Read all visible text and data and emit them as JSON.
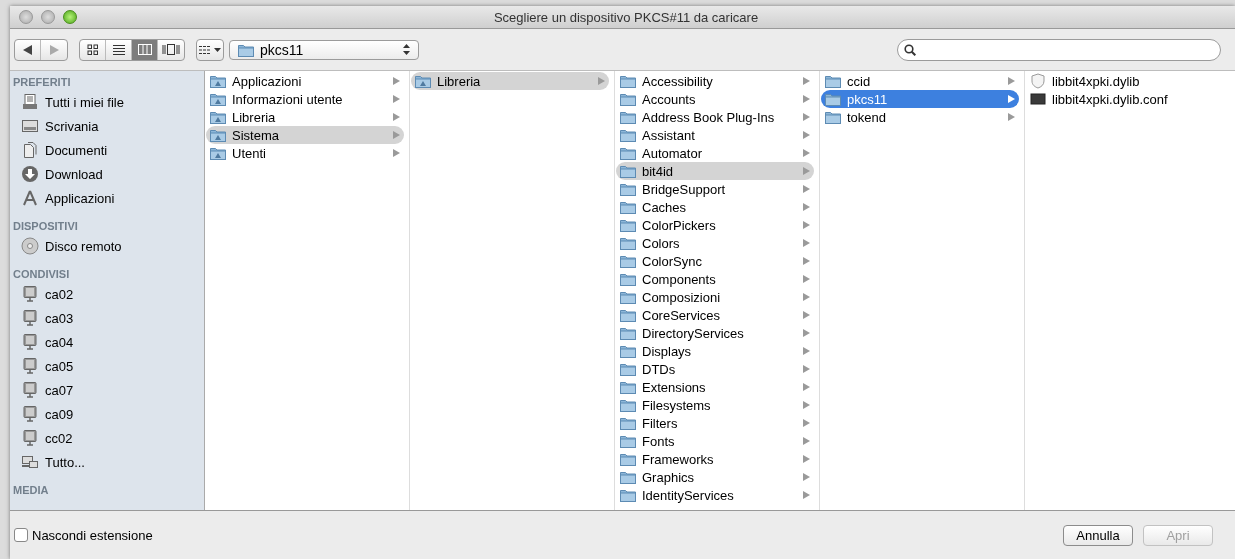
{
  "window": {
    "title": "Scegliere un dispositivo PKCS#11 da caricare"
  },
  "toolbar": {
    "view_buttons": [
      {
        "kind": "icons",
        "selected": false
      },
      {
        "kind": "list",
        "selected": false
      },
      {
        "kind": "columns",
        "selected": true
      },
      {
        "kind": "coverflow",
        "selected": false
      }
    ],
    "path_popup": "pkcs11"
  },
  "sidebar": {
    "sections": [
      {
        "title": "PREFERITI",
        "items": [
          {
            "label": "Tutti i miei file",
            "kind": "all-files"
          },
          {
            "label": "Scrivania",
            "kind": "desktop"
          },
          {
            "label": "Documenti",
            "kind": "documents"
          },
          {
            "label": "Download",
            "kind": "download"
          },
          {
            "label": "Applicazioni",
            "kind": "applications"
          }
        ]
      },
      {
        "title": "DISPOSITIVI",
        "items": [
          {
            "label": "Disco remoto",
            "kind": "disc"
          }
        ]
      },
      {
        "title": "CONDIVISI",
        "items": [
          {
            "label": "ca02",
            "kind": "computer"
          },
          {
            "label": "ca03",
            "kind": "computer"
          },
          {
            "label": "ca04",
            "kind": "computer"
          },
          {
            "label": "ca05",
            "kind": "computer"
          },
          {
            "label": "ca07",
            "kind": "computer"
          },
          {
            "label": "ca09",
            "kind": "computer"
          },
          {
            "label": "cc02",
            "kind": "computer"
          },
          {
            "label": "Tutto...",
            "kind": "network"
          }
        ]
      },
      {
        "title": "MEDIA"
      }
    ]
  },
  "columns": [
    {
      "items": [
        {
          "name": "Applicazioni",
          "kind": "special-folder",
          "selected": false
        },
        {
          "name": "Informazioni utente",
          "kind": "special-folder",
          "selected": false
        },
        {
          "name": "Libreria",
          "kind": "special-folder",
          "selected": false
        },
        {
          "name": "Sistema",
          "kind": "special-folder",
          "selected": true
        },
        {
          "name": "Utenti",
          "kind": "special-folder",
          "selected": false
        }
      ]
    },
    {
      "items": [
        {
          "name": "Libreria",
          "kind": "special-folder",
          "selected": true
        }
      ]
    },
    {
      "items": [
        {
          "name": "Accessibility",
          "kind": "folder",
          "selected": false
        },
        {
          "name": "Accounts",
          "kind": "folder",
          "selected": false
        },
        {
          "name": "Address Book Plug-Ins",
          "kind": "folder",
          "selected": false
        },
        {
          "name": "Assistant",
          "kind": "folder",
          "selected": false
        },
        {
          "name": "Automator",
          "kind": "folder",
          "selected": false
        },
        {
          "name": "bit4id",
          "kind": "folder",
          "selected": true
        },
        {
          "name": "BridgeSupport",
          "kind": "folder",
          "selected": false
        },
        {
          "name": "Caches",
          "kind": "folder",
          "selected": false
        },
        {
          "name": "ColorPickers",
          "kind": "folder",
          "selected": false
        },
        {
          "name": "Colors",
          "kind": "folder",
          "selected": false
        },
        {
          "name": "ColorSync",
          "kind": "folder",
          "selected": false
        },
        {
          "name": "Components",
          "kind": "folder",
          "selected": false
        },
        {
          "name": "Composizioni",
          "kind": "folder",
          "selected": false
        },
        {
          "name": "CoreServices",
          "kind": "folder",
          "selected": false
        },
        {
          "name": "DirectoryServices",
          "kind": "folder",
          "selected": false
        },
        {
          "name": "Displays",
          "kind": "folder",
          "selected": false
        },
        {
          "name": "DTDs",
          "kind": "folder",
          "selected": false
        },
        {
          "name": "Extensions",
          "kind": "folder",
          "selected": false
        },
        {
          "name": "Filesystems",
          "kind": "folder",
          "selected": false
        },
        {
          "name": "Filters",
          "kind": "folder",
          "selected": false
        },
        {
          "name": "Fonts",
          "kind": "folder",
          "selected": false
        },
        {
          "name": "Frameworks",
          "kind": "folder",
          "selected": false
        },
        {
          "name": "Graphics",
          "kind": "folder",
          "selected": false
        },
        {
          "name": "IdentityServices",
          "kind": "folder",
          "selected": false
        }
      ]
    },
    {
      "items": [
        {
          "name": "ccid",
          "kind": "folder",
          "selected": false
        },
        {
          "name": "pkcs11",
          "kind": "folder",
          "selected": true
        },
        {
          "name": "tokend",
          "kind": "folder",
          "selected": false
        }
      ]
    },
    {
      "items": [
        {
          "name": "libbit4xpki.dylib",
          "kind": "library-file",
          "selected": false
        },
        {
          "name": "libbit4xpki.dylib.conf",
          "kind": "text-file",
          "selected": false
        }
      ]
    }
  ],
  "footer": {
    "hide_extension": {
      "label": "Nascondi estensione",
      "checked": false
    },
    "buttons": [
      {
        "label": "Annulla",
        "disabled": false
      },
      {
        "label": "Apri",
        "disabled": true
      }
    ]
  }
}
